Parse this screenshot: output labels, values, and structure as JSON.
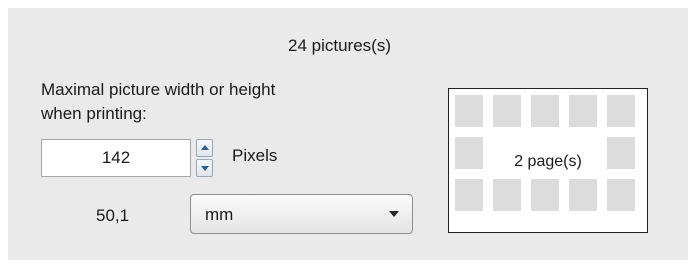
{
  "picture_count_text": "24 pictures(s)",
  "max_size_label": {
    "line1": "Maximal picture width or height",
    "line2": "when printing:"
  },
  "size_input": {
    "value": "142"
  },
  "unit_label": "Pixels",
  "converted_value": "50,1",
  "unit_select": {
    "selected": "mm"
  },
  "preview": {
    "pages_text": "2 page(s)",
    "thumbnail_rows": 3,
    "thumbnail_cols": 5
  },
  "colors": {
    "panel_bg": "#eaeaea",
    "thumbnail": "#dcdcdc",
    "spin_arrow": "#2d5e8c"
  },
  "icons": {
    "spin_up": "triangle-up-icon",
    "spin_down": "triangle-down-icon",
    "dropdown": "chevron-down-icon"
  }
}
